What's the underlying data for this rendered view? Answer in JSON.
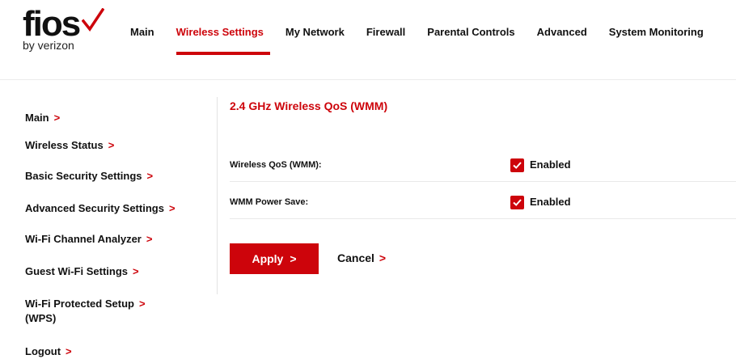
{
  "brand": {
    "logo_word": "fios",
    "logo_sub": "by verizon",
    "accent_color": "#cd040b"
  },
  "topnav": {
    "items": [
      {
        "label": "Main"
      },
      {
        "label": "Wireless Settings",
        "active": true
      },
      {
        "label": "My Network"
      },
      {
        "label": "Firewall"
      },
      {
        "label": "Parental Controls"
      },
      {
        "label": "Advanced"
      },
      {
        "label": "System Monitoring"
      }
    ]
  },
  "sidebar": {
    "items": [
      {
        "label": "Main"
      },
      {
        "label": "Wireless Status"
      },
      {
        "label": "Basic Security Settings"
      },
      {
        "label": "Advanced Security Settings"
      },
      {
        "label": "Wi-Fi Channel Analyzer"
      },
      {
        "label": "Guest Wi-Fi Settings"
      },
      {
        "label": "Wi-Fi Protected Setup",
        "label_line2": "(WPS)"
      },
      {
        "label": "Logout"
      }
    ],
    "chevron": ">"
  },
  "main": {
    "title": "2.4 GHz Wireless QoS (WMM)",
    "settings": [
      {
        "label": "Wireless QoS (WMM):",
        "checked": true,
        "value_label": "Enabled"
      },
      {
        "label": "WMM Power Save:",
        "checked": true,
        "value_label": "Enabled"
      }
    ],
    "apply_label": "Apply",
    "cancel_label": "Cancel"
  }
}
